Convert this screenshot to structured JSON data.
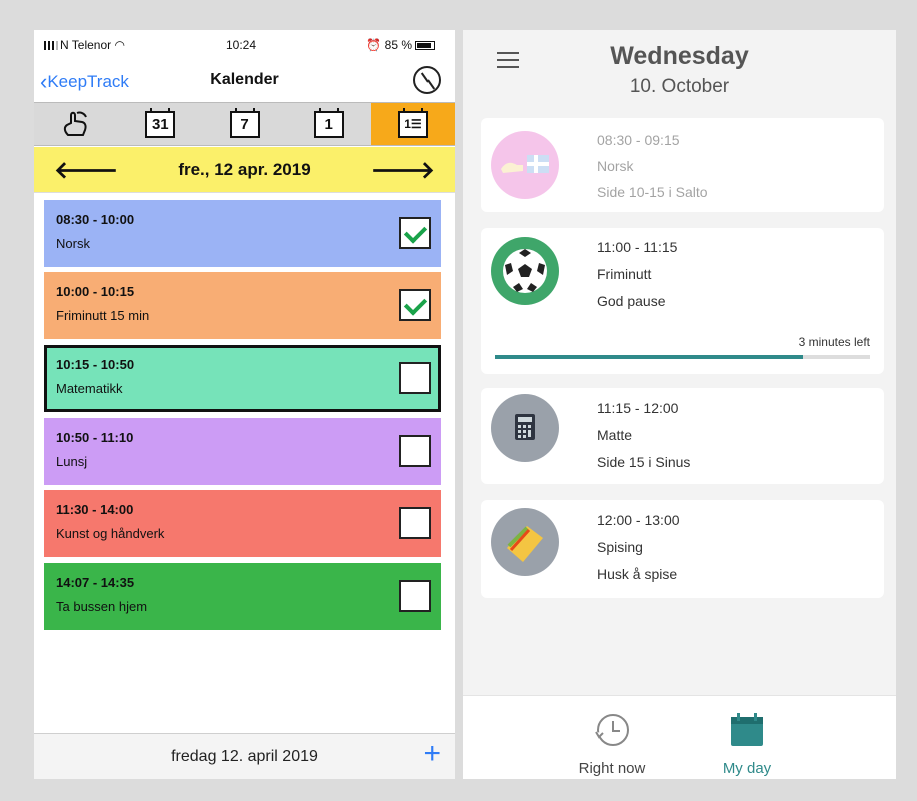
{
  "left_app": {
    "status_bar": {
      "carrier": "N Telenor",
      "time": "10:24",
      "battery": "85 %"
    },
    "nav": {
      "back_label": "KeepTrack",
      "title": "Kalender"
    },
    "view_tabs": {
      "month": "31",
      "week": "7",
      "day": "1",
      "list_icon": "day-list-icon",
      "touch_icon": "touch-hand-icon"
    },
    "date_bar": {
      "label": "fre., 12 apr. 2019"
    },
    "events": [
      {
        "time": "08:30 - 10:00",
        "name": "Norsk",
        "color": "#9bb3f5",
        "done": true
      },
      {
        "time": "10:00 - 10:15",
        "name": "Friminutt 15 min",
        "color": "#f8ad74",
        "done": true
      },
      {
        "time": "10:15 - 10:50",
        "name": "Matematikk",
        "color": "#76e3b9",
        "done": false
      },
      {
        "time": "10:50 - 11:10",
        "name": "Lunsj",
        "color": "#cc9cf5",
        "done": false
      },
      {
        "time": "11:30 - 14:00",
        "name": "Kunst og håndverk",
        "color": "#f6786d",
        "done": false
      },
      {
        "time": "14:07 - 14:35",
        "name": "Ta bussen hjem",
        "color": "#3ab54a",
        "done": false
      }
    ],
    "footer": {
      "date": "fredag 12. april 2019",
      "add": "+"
    }
  },
  "right_app": {
    "header": {
      "day": "Wednesday",
      "date": "10. October"
    },
    "cards": [
      {
        "time": "08:30 - 09:15",
        "subject": "Norsk",
        "note": "Side 10-15 i Salto",
        "icon": "norwegian-flag-icon",
        "color": "#e97fd2"
      },
      {
        "time": "11:00 - 11:15",
        "subject": "Friminutt",
        "note": "God pause",
        "icon": "football-icon",
        "color": "#3fa66a",
        "progress_label": "3 minutes left",
        "progress": 0.82
      },
      {
        "time": "11:15 - 12:00",
        "subject": "Matte",
        "note": "Side 15 i Sinus",
        "icon": "calculator-icon",
        "color": "#9aa1aa"
      },
      {
        "time": "12:00 - 13:00",
        "subject": "Spising",
        "note": "Husk å spise",
        "icon": "sandwich-icon",
        "color": "#9aa1aa"
      }
    ],
    "bottom_nav": {
      "right_now": "Right now",
      "my_day": "My day",
      "accent": "#2f8a8a"
    }
  }
}
